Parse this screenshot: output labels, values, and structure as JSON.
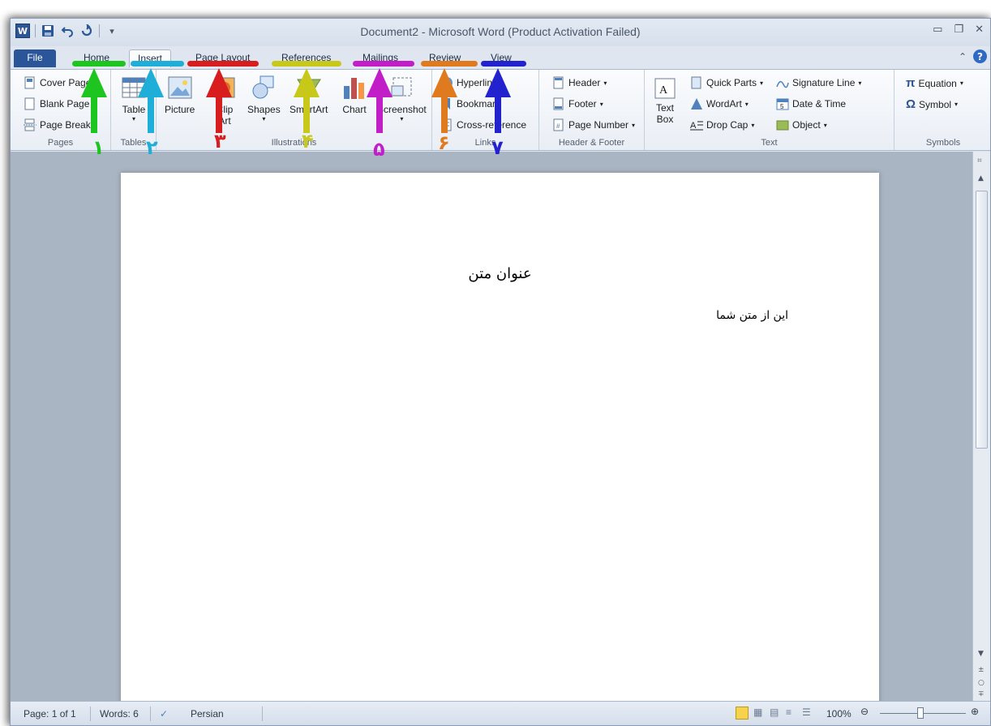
{
  "window": {
    "title": "Document2  -  Microsoft Word (Product Activation Failed)"
  },
  "quick_access": {
    "icons": [
      "word-logo",
      "save-icon",
      "undo-icon",
      "redo-icon",
      "customize-icon"
    ]
  },
  "tabs": [
    {
      "label": "File",
      "color": "#2a5699"
    },
    {
      "label": "Home",
      "color": "#1ec51e"
    },
    {
      "label": "Insert",
      "color": "#1faed8"
    },
    {
      "label": "Page Layout",
      "color": "#d71d1d"
    },
    {
      "label": "References",
      "color": "#c8c81a"
    },
    {
      "label": "Mailings",
      "color": "#c21ec8"
    },
    {
      "label": "Review",
      "color": "#e07a1f"
    },
    {
      "label": "View",
      "color": "#2222cf"
    }
  ],
  "ribbon": {
    "pages": {
      "label": "Pages",
      "items": [
        "Cover Page",
        "Blank Page",
        "Page Break"
      ]
    },
    "tables": {
      "label": "Tables",
      "table": "Table"
    },
    "illustrations": {
      "label": "Illustrations",
      "picture": "Picture",
      "clip_art_1": "Clip",
      "clip_art_2": "Art",
      "shapes": "Shapes",
      "smartart": "SmartArt",
      "chart": "Chart",
      "screenshot": "Screenshot"
    },
    "links": {
      "label": "Links",
      "items": [
        "Hyperlink",
        "Bookmark",
        "Cross-reference"
      ]
    },
    "header_footer": {
      "label": "Header & Footer",
      "items": [
        "Header",
        "Footer",
        "Page Number"
      ]
    },
    "text": {
      "label": "Text",
      "text_box_1": "Text",
      "text_box_2": "Box",
      "col1": [
        "Quick Parts",
        "WordArt",
        "Drop Cap"
      ],
      "col2": [
        "Signature Line",
        "Date & Time",
        "Object"
      ]
    },
    "symbols": {
      "label": "Symbols",
      "items": [
        "Equation",
        "Symbol"
      ]
    }
  },
  "annotations": {
    "numbers": [
      "۱",
      "۲",
      "۳",
      "۴",
      "۵",
      "۶",
      "۷"
    ],
    "colors": [
      "#1ec51e",
      "#1faed8",
      "#d71d1d",
      "#c8c81a",
      "#c21ec8",
      "#e07a1f",
      "#2222cf"
    ]
  },
  "document": {
    "title": "عنوان متن",
    "body": "این از متن شما"
  },
  "status": {
    "page": "Page: 1 of 1",
    "words": "Words: 6",
    "language": "Persian",
    "zoom": "100%"
  }
}
